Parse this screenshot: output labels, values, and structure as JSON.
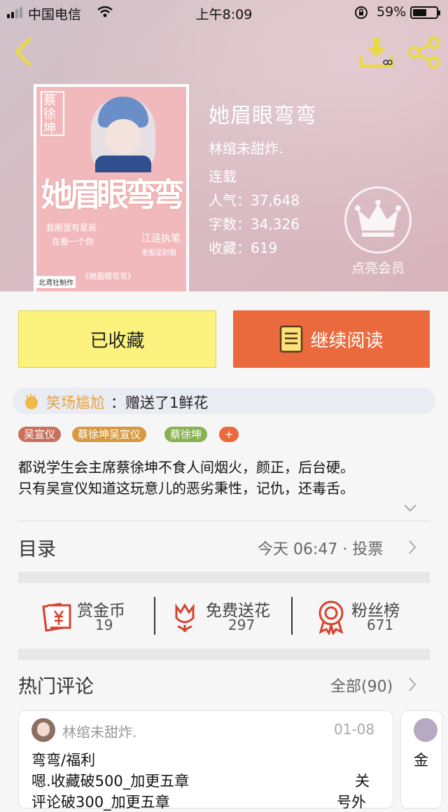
{
  "status_bar": {
    "carrier": "中国电信",
    "time": "上午8:09",
    "battery_pct": "59%",
    "battery_level": 0.59
  },
  "header": {
    "back_icon": "chevron-left-icon",
    "download_icon": "download-icon",
    "share_icon": "share-icon"
  },
  "book": {
    "title": "她眉眼弯弯",
    "author": "林绾未甜炸.",
    "status": "连载",
    "popularity": "人气：37,648",
    "word_count": "字数：34,326",
    "favorites": "收藏：619",
    "cover": {
      "side_title": "蔡徐坤",
      "big_title": "她眉眼弯弯",
      "line1": "我眼里有星辰",
      "line2": "在看一个你",
      "line3": "江涟执笔",
      "line4": "老板定封面",
      "bottom_title": "《她眉眼弯弯》",
      "studio": "北鸢社制作"
    }
  },
  "membership": {
    "label": "点亮会员"
  },
  "actions": {
    "favorited": "已收藏",
    "continue_reading": "继续阅读"
  },
  "gift": {
    "user": "笑场尴尬",
    "message": "：赠送了1鲜花"
  },
  "tags": [
    {
      "label": "吴宣仪",
      "color": "#c8725e"
    },
    {
      "label": "蔡徐坤吴宣仪",
      "color": "#d69a3e"
    },
    {
      "label": "蔡徐坤",
      "color": "#88b14f"
    },
    {
      "label": "+",
      "color": "#ea6a3e"
    }
  ],
  "intro": {
    "line1": "都说学生会主席蔡徐坤不食人间烟火，颜正，后台硬。",
    "line2": "只有吴宣仪知道这玩意儿的恶劣秉性，记仇，还毒舌。"
  },
  "catalog": {
    "title": "目录",
    "update": "今天 06:47 · 投票"
  },
  "stats": [
    {
      "label": "赏金币",
      "value": "19",
      "icon": "coin-icon"
    },
    {
      "label": "免费送花",
      "value": "297",
      "icon": "flower-icon"
    },
    {
      "label": "粉丝榜",
      "value": "671",
      "icon": "award-icon"
    }
  ],
  "comments": {
    "title": "热门评论",
    "all": "全部(90)",
    "items": [
      {
        "user": "林绾未甜炸.",
        "date": "01-08",
        "line1": "弯弯/福利",
        "line2": "嗯.收藏破500_加更五章",
        "line3": "评论破300_加更五章",
        "right1": "关",
        "right2": "号外"
      },
      {
        "line1": "金"
      }
    ]
  },
  "colors": {
    "accent": "#eb6a3d",
    "favorite_btn": "#fbf37e",
    "gift_user": "#e9a23b"
  }
}
